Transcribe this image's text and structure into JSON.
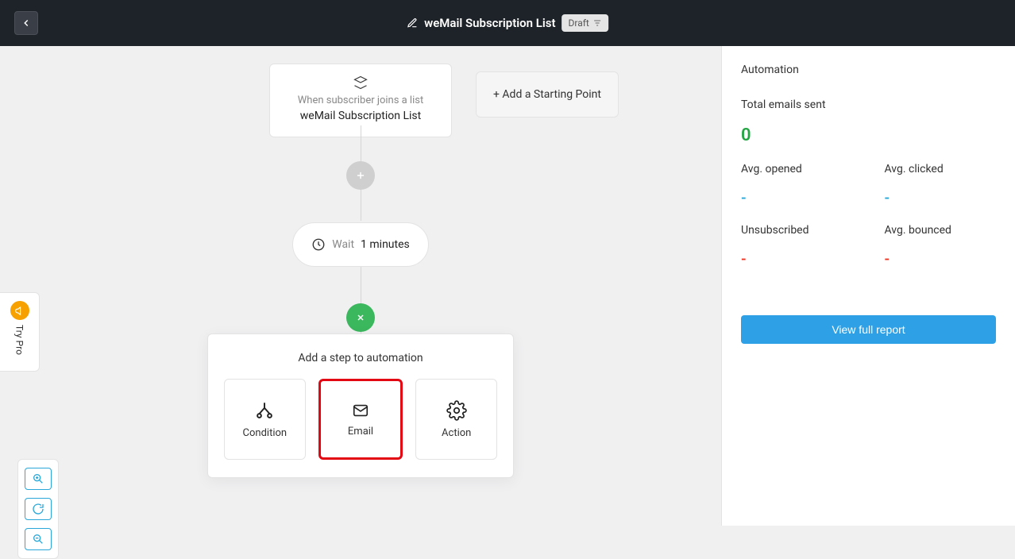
{
  "topbar": {
    "title": "weMail Subscription List",
    "badge": "Draft"
  },
  "canvas": {
    "start_node": {
      "subtitle": "When subscriber joins a list",
      "title": "weMail Subscription List"
    },
    "add_starting_point": "+ Add a Starting Point",
    "wait_node": {
      "label": "Wait",
      "value": "1 minutes"
    },
    "step_popup": {
      "title": "Add a step to automation",
      "options": {
        "condition": "Condition",
        "email": "Email",
        "action": "Action"
      }
    }
  },
  "sidebar": {
    "title": "Automation",
    "total_label": "Total emails sent",
    "total_value": "0",
    "avg_opened_label": "Avg. opened",
    "avg_opened_value": "-",
    "avg_clicked_label": "Avg. clicked",
    "avg_clicked_value": "-",
    "unsub_label": "Unsubscribed",
    "unsub_value": "-",
    "bounced_label": "Avg. bounced",
    "bounced_value": "-",
    "view_report": "View full report"
  },
  "trypro": "Try Pro"
}
